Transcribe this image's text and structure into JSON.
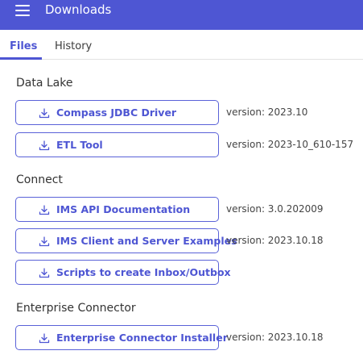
{
  "header": {
    "title": "Downloads",
    "menu_icon": "hamburger-menu-icon"
  },
  "tabs": [
    {
      "label": "Files",
      "active": true
    },
    {
      "label": "History",
      "active": false
    }
  ],
  "sections": [
    {
      "title": "Data Lake",
      "items": [
        {
          "label": "Compass JDBC Driver",
          "version": "version: 2023.10"
        },
        {
          "label": "ETL Tool",
          "version": "version: 2023-10_610-157"
        }
      ]
    },
    {
      "title": "Connect",
      "items": [
        {
          "label": "IMS API Documentation",
          "version": "version: 3.0.202009"
        },
        {
          "label": "IMS Client and Server Examples",
          "version": "version: 2023.10.18"
        },
        {
          "label": "Scripts to create Inbox/Outbox",
          "version": ""
        }
      ]
    },
    {
      "title": "Enterprise Connector",
      "items": [
        {
          "label": "Enterprise Connector Installer",
          "version": "version: 2023.10.18"
        }
      ]
    }
  ],
  "colors": {
    "accent": "#4e56d3",
    "button_border": "#5a62d8"
  },
  "icons": {
    "download": "download-icon"
  }
}
